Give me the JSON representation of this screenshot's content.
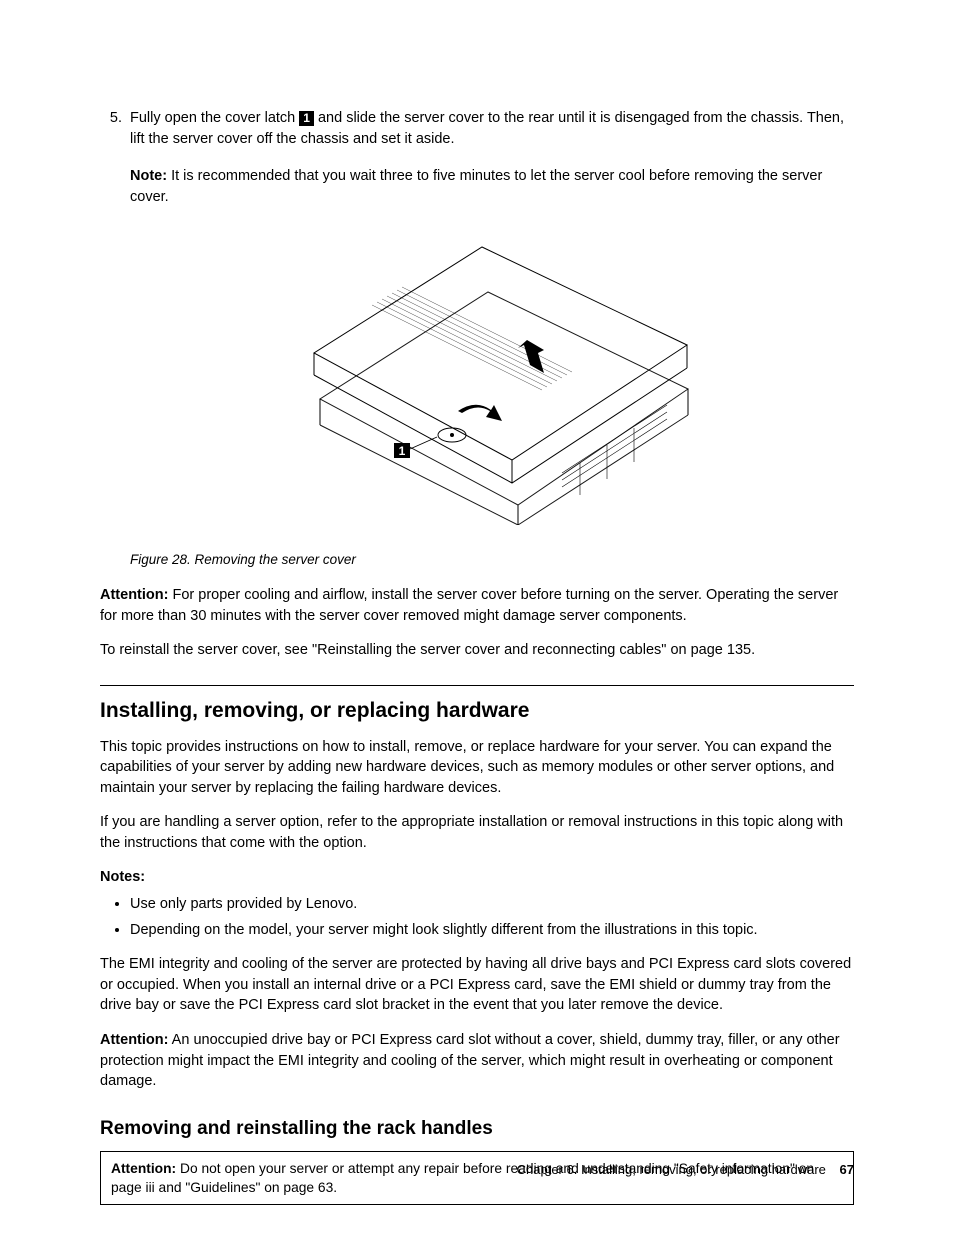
{
  "step": {
    "number": "5.",
    "text_before": "Fully open the cover latch ",
    "callout": "1",
    "text_after": " and slide the server cover to the rear until it is disengaged from the chassis. Then, lift the server cover off the chassis and set it aside.",
    "note_label": "Note:",
    "note_text": " It is recommended that you wait three to five minutes to let the server cool before removing the server cover."
  },
  "figure": {
    "callout": "1",
    "caption": "Figure 28.  Removing the server cover"
  },
  "attention1": {
    "label": "Attention:",
    "text": " For proper cooling and airflow, install the server cover before turning on the server. Operating the server for more than 30 minutes with the server cover removed might damage server components."
  },
  "reinstall_text": "To reinstall the server cover, see \"Reinstalling the server cover and reconnecting cables\" on page 135.",
  "section1": {
    "heading": "Installing, removing, or replacing hardware",
    "p1": "This topic provides instructions on how to install, remove, or replace hardware for your server. You can expand the capabilities of your server by adding new hardware devices, such as memory modules or other server options, and maintain your server by replacing the failing hardware devices.",
    "p2": "If you are handling a server option, refer to the appropriate installation or removal instructions in this topic along with the instructions that come with the option.",
    "notes_label": "Notes:",
    "bullet1": "Use only parts provided by Lenovo.",
    "bullet2": "Depending on the model, your server might look slightly different from the illustrations in this topic.",
    "p3": "The EMI integrity and cooling of the server are protected by having all drive bays and PCI Express card slots covered or occupied. When you install an internal drive or a PCI Express card, save the EMI shield or dummy tray from the drive bay or save the PCI Express card slot bracket in the event that you later remove the device.",
    "attention_label": "Attention:",
    "attention_text": " An unoccupied drive bay or PCI Express card slot without a cover, shield, dummy tray, filler, or any other protection might impact the EMI integrity and cooling of the server, which might result in overheating or component damage."
  },
  "section2": {
    "heading": "Removing and reinstalling the rack handles",
    "box_label": "Attention:",
    "box_text": " Do not open your server or attempt any repair before reading and understanding \"Safety information\" on page iii and \"Guidelines\" on page 63."
  },
  "footer": {
    "chapter": "Chapter 6.  Installing, removing, or replacing hardware",
    "page": "67"
  }
}
